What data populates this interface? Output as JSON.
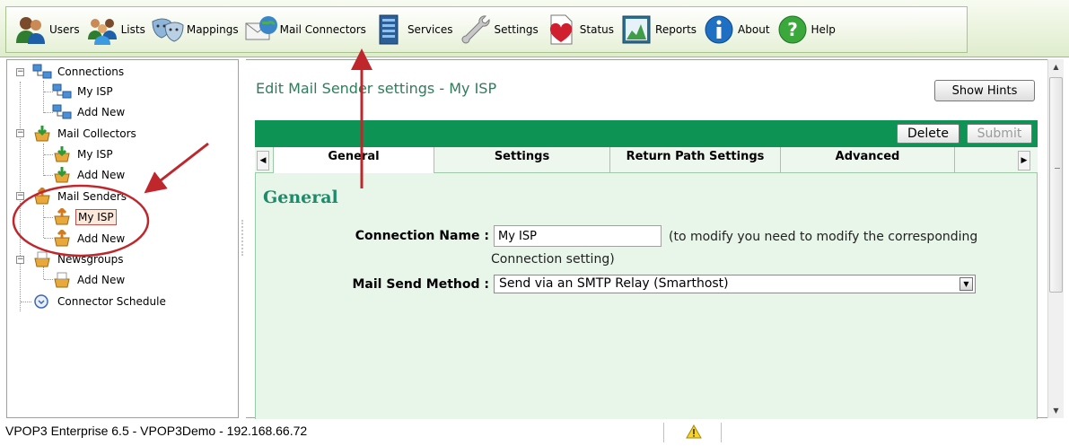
{
  "toolbar": {
    "items": [
      {
        "label": "Users",
        "icon": "users-icon"
      },
      {
        "label": "Lists",
        "icon": "lists-icon"
      },
      {
        "label": "Mappings",
        "icon": "mappings-icon"
      },
      {
        "label": "Mail Connectors",
        "icon": "mail-connectors-icon"
      },
      {
        "label": "Services",
        "icon": "services-icon"
      },
      {
        "label": "Settings",
        "icon": "settings-icon"
      },
      {
        "label": "Status",
        "icon": "status-icon"
      },
      {
        "label": "Reports",
        "icon": "reports-icon"
      },
      {
        "label": "About",
        "icon": "about-icon"
      },
      {
        "label": "Help",
        "icon": "help-icon"
      }
    ]
  },
  "tree": {
    "connections": {
      "label": "Connections",
      "children": [
        "My ISP",
        "Add New"
      ]
    },
    "mail_collectors": {
      "label": "Mail Collectors",
      "children": [
        "My ISP",
        "Add New"
      ]
    },
    "mail_senders": {
      "label": "Mail Senders",
      "children": [
        "My ISP",
        "Add New"
      ],
      "selected": "My ISP"
    },
    "newsgroups": {
      "label": "Newsgroups",
      "children": [
        "Add New"
      ]
    },
    "connector_schedule": {
      "label": "Connector Schedule"
    }
  },
  "main": {
    "page_title": "Edit Mail Sender settings - My ISP",
    "show_hints_label": "Show Hints",
    "delete_label": "Delete",
    "submit_label": "Submit",
    "tabs": [
      {
        "label": "General",
        "active": true
      },
      {
        "label": "Settings"
      },
      {
        "label": "Return Path Settings"
      },
      {
        "label": "Advanced"
      }
    ],
    "section_title": "General",
    "connection_name_label": "Connection Name :",
    "connection_name_value": "My ISP",
    "connection_name_hint_1": "(to modify you need to modify the corresponding",
    "connection_name_hint_2": "Connection setting)",
    "send_method_label": "Mail Send Method :",
    "send_method_value": "Send via an SMTP Relay (Smarthost)"
  },
  "status_bar": {
    "text": "VPOP3 Enterprise 6.5 - VPOP3Demo - 192.168.66.72",
    "warning_icon": "warning-icon"
  },
  "colors": {
    "accent_green": "#0d9353",
    "title_green": "#2e7d5b",
    "form_bg": "#e8f5e9",
    "annotation_red": "#c0272d"
  }
}
